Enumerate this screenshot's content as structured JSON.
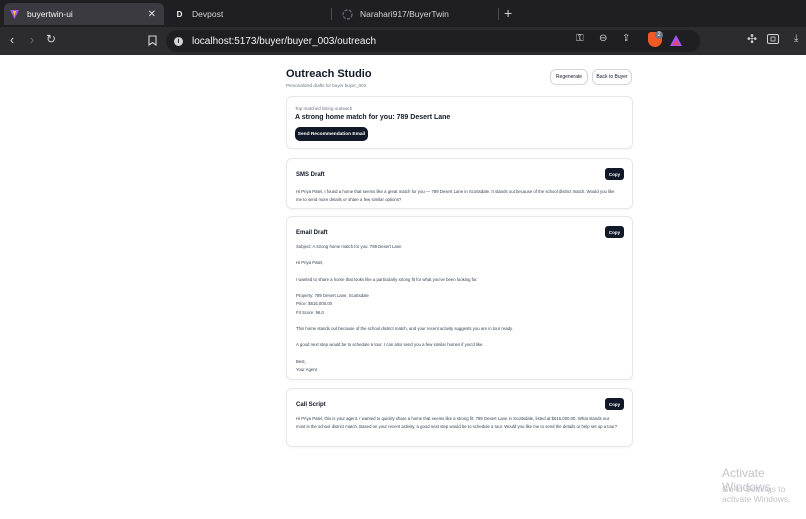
{
  "browser": {
    "tabs": [
      {
        "title": "buyertwin-ui",
        "active": true,
        "icon": "vite-icon"
      },
      {
        "title": "Devpost",
        "active": false,
        "icon": "devpost-icon",
        "icon_glyph": "D"
      },
      {
        "title": "Narahari917/BuyerTwin",
        "active": false,
        "icon": "github-icon"
      }
    ],
    "url": "localhost:5173/buyer/buyer_003/outreach",
    "brave_badge_count": "2"
  },
  "header": {
    "title": "Outreach Studio",
    "subtitle": "Personalized drafts for buyer buyer_003",
    "regenerate_label": "Regenerate",
    "back_label": "Back to Buyer"
  },
  "top_match": {
    "label": "Top matched listing outreach",
    "headline": "A strong home match for you: 789 Desert Lane",
    "button_label": "Send Recommendation Email"
  },
  "sms": {
    "title": "SMS Draft",
    "copy_label": "Copy",
    "body": "Hi Priya Patel, I found a home that seems like a great match for you — 789 Desert Lane in Scottsdale. It stands out because of the school district match. Would you like me to send more details or share a few similar options?"
  },
  "email": {
    "title": "Email Draft",
    "copy_label": "Copy",
    "lines": [
      "Subject: A strong home match for you: 789 Desert Lane",
      "",
      "Hi Priya Patel,",
      "",
      "I wanted to share a home that looks like a particularly strong fit for what you've been looking for.",
      "",
      "Property: 789 Desert Lane, Scottsdale",
      "Price: $615,000.00",
      "Fit Score: 96.0",
      "",
      "This home stands out because of the school district match, and your recent activity suggests you are in tour ready.",
      "",
      "A good next step would be to schedule a tour. I can also send you a few similar homes if you'd like.",
      "",
      "Best,",
      "Your Agent"
    ]
  },
  "call": {
    "title": "Call Script",
    "copy_label": "Copy",
    "body": "Hi Priya Patel, this is your agent. I wanted to quickly share a home that seems like a strong fit: 789 Desert Lane in Scottsdale, listed at $615,000.00. What stands out most is the school district match. Based on your recent activity, a good next step would be to schedule a tour. Would you like me to send the details or help set up a tour?"
  },
  "watermark": {
    "line1": "Activate Windows",
    "line2": "Go to Settings to activate Windows."
  }
}
